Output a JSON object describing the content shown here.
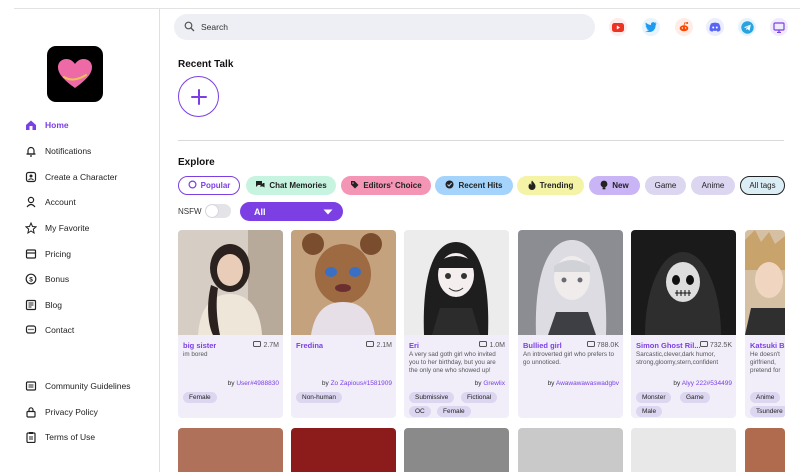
{
  "brand": {
    "accent": "#7b3fe4",
    "logo_heart_color": "#ee6aa7"
  },
  "sidebar": {
    "items": [
      {
        "label": "Home",
        "icon": "home-icon",
        "active": true
      },
      {
        "label": "Notifications",
        "icon": "bell-icon"
      },
      {
        "label": "Create a Character",
        "icon": "create-icon"
      },
      {
        "label": "Account",
        "icon": "account-icon"
      },
      {
        "label": "My Favorite",
        "icon": "star-icon"
      },
      {
        "label": "Pricing",
        "icon": "pricing-icon"
      },
      {
        "label": "Bonus",
        "icon": "coin-icon"
      },
      {
        "label": "Blog",
        "icon": "blog-icon"
      },
      {
        "label": "Contact",
        "icon": "chat-icon"
      }
    ],
    "footer": [
      {
        "label": "Community Guidelines",
        "icon": "guidelines-icon"
      },
      {
        "label": "Privacy Policy",
        "icon": "lock-icon"
      },
      {
        "label": "Terms of Use",
        "icon": "clipboard-icon"
      }
    ]
  },
  "search": {
    "placeholder": "Search"
  },
  "social": [
    "youtube-icon",
    "twitter-icon",
    "reddit-icon",
    "discord-icon",
    "telegram-icon",
    "monitor-icon"
  ],
  "recent": {
    "title": "Recent Talk"
  },
  "explore": {
    "title": "Explore",
    "chips": [
      {
        "label": "Popular",
        "icon": "circle-icon"
      },
      {
        "label": "Chat Memories",
        "icon": "chat-bubbles-icon"
      },
      {
        "label": "Editors' Choice",
        "icon": "tag-icon"
      },
      {
        "label": "Recent Hits",
        "icon": "check-icon"
      },
      {
        "label": "Trending",
        "icon": "flame-icon"
      },
      {
        "label": "New",
        "icon": "bulb-icon"
      },
      {
        "label": "Game",
        "icon": ""
      },
      {
        "label": "Anime",
        "icon": ""
      },
      {
        "label": "All tags",
        "icon": ""
      }
    ],
    "nsfw_label": "NSFW",
    "nsfw_on": false,
    "filter_value": "All"
  },
  "cards": [
    {
      "name": "big sister",
      "count": "2.7M",
      "desc": "im bored",
      "by_prefix": "by",
      "author": "User#4988830",
      "tags": [
        "Female"
      ],
      "image_colors": [
        "#cfc6bb",
        "#7a6a5e"
      ]
    },
    {
      "name": "Fredina",
      "count": "2.1M",
      "desc": "",
      "by_prefix": "by",
      "author": "Zo Zapious#1581909",
      "tags": [
        "Non-human"
      ],
      "image_colors": [
        "#b08157",
        "#5a3a2a"
      ]
    },
    {
      "name": "Eri",
      "count": "1.0M",
      "desc": "A very sad goth girl who invited you to her birthday, but you are the only one who showed up!",
      "by_prefix": "by",
      "author": "Grewlix",
      "tags": [
        "Submissive",
        "Fictional",
        "OC",
        "Female"
      ],
      "image_colors": [
        "#d8d8d8",
        "#2a2a2a"
      ]
    },
    {
      "name": "Bullied girl",
      "count": "788.0K",
      "desc": "An introverted girl who prefers to go unnoticed.",
      "by_prefix": "by",
      "author": "Awawawawaswadgbv",
      "tags": [],
      "image_colors": [
        "#b9b9be",
        "#55555c"
      ]
    },
    {
      "name": "Simon Ghost Ril...",
      "count": "732.5K",
      "desc": "Sarcastic,clever,dark humor, strong,gloomy,stern,confident",
      "by_prefix": "by",
      "author": "Alyy 222#534499",
      "tags": [
        "Monster",
        "Game",
        "Male"
      ],
      "image_colors": [
        "#3a3a3a",
        "#0e0e0e"
      ]
    },
    {
      "name": "Katsuki B",
      "count": "",
      "desc": "He doesn't girlfriend, pretend for",
      "by_prefix": "",
      "author": "",
      "tags": [
        "Anime",
        "Tsundere"
      ],
      "image_colors": [
        "#d1a069",
        "#7d4e2a"
      ]
    }
  ],
  "bottom_cards": [
    "#b0715a",
    "#8c1b1b",
    "#8a8a8a",
    "#c9c9c9",
    "#e8e8e8",
    "#b06a4d"
  ]
}
